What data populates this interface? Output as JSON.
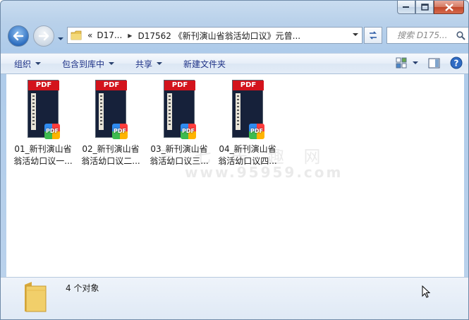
{
  "window": {
    "caption_buttons": [
      "minimize",
      "maximize",
      "close"
    ]
  },
  "address_bar": {
    "overflow": "«",
    "segments": [
      "D17...",
      "D17562 《新刊演山省翁活幼口议》元曾..."
    ]
  },
  "search": {
    "placeholder": "搜索 D175..."
  },
  "toolbar": {
    "organize": "组织",
    "include_in_library": "包含到库中",
    "share": "共享",
    "new_folder": "新建文件夹"
  },
  "files": [
    {
      "line1": "01_新刊演山省",
      "line2": "翁活幼口议一...",
      "type_label": "PDF"
    },
    {
      "line1": "02_新刊演山省",
      "line2": "翁活幼口议二...",
      "type_label": "PDF"
    },
    {
      "line1": "03_新刊演山省",
      "line2": "翁活幼口议三...",
      "type_label": "PDF"
    },
    {
      "line1": "04_新刊演山省",
      "line2": "翁活幼口议四...",
      "type_label": "PDF"
    }
  ],
  "watermark": {
    "text": "三 七 乐 趣 网",
    "url": "www.95959.com"
  },
  "details": {
    "count_text": "4 个对象"
  },
  "colors": {
    "pdf_red": "#d3131c",
    "toolbar_text": "#1e3287",
    "window_frame": "#aecbea"
  }
}
